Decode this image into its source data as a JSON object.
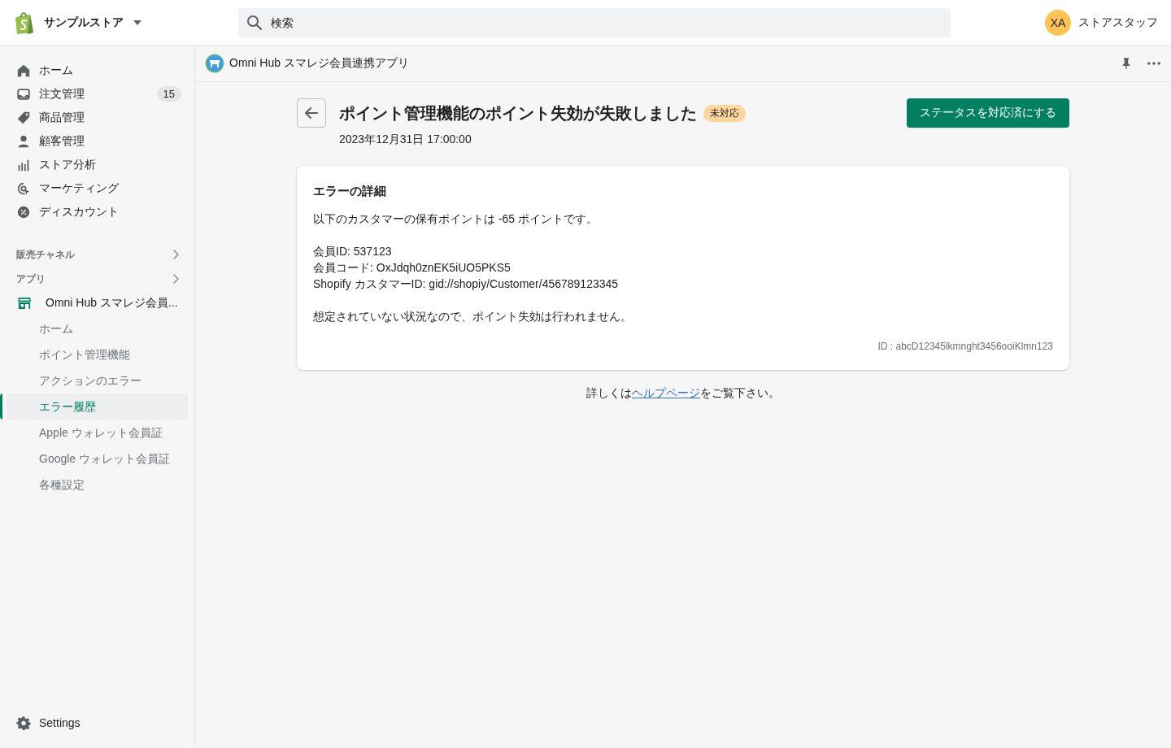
{
  "topbar": {
    "store_name": "サンプルストア",
    "search": {
      "placeholder": "検索"
    },
    "user": {
      "initials": "XA",
      "name": "ストアスタッフ"
    }
  },
  "sidebar": {
    "items": [
      {
        "label": "ホーム"
      },
      {
        "label": "注文管理",
        "badge": "15"
      },
      {
        "label": "商品管理"
      },
      {
        "label": "顧客管理"
      },
      {
        "label": "ストア分析"
      },
      {
        "label": "マーケティング"
      },
      {
        "label": "ディスカウント"
      }
    ],
    "sections": [
      {
        "label": "販売チャネル"
      },
      {
        "label": "アプリ"
      }
    ],
    "app": {
      "label": "Omni Hub スマレジ会員...",
      "children": [
        {
          "label": "ホーム",
          "selected": false
        },
        {
          "label": "ポイント管理機能",
          "selected": false
        },
        {
          "label": "アクションのエラー",
          "selected": false
        },
        {
          "label": "エラー履歴",
          "selected": true
        },
        {
          "label": "Apple ウォレット会員証",
          "selected": false
        },
        {
          "label": "Google ウォレット会員証",
          "selected": false
        },
        {
          "label": "各種設定",
          "selected": false
        }
      ]
    },
    "settings": "Settings"
  },
  "app_header": {
    "title": "Omni Hub スマレジ会員連携アプリ"
  },
  "page": {
    "title": "ポイント管理機能のポイント失効が失敗しました",
    "status": "未対応",
    "date": "2023年12月31日 17:00:00",
    "action": "ステータスを対応済にする",
    "card": {
      "heading": "エラーの詳細",
      "paragraphs": [
        [
          "以下のカスタマーの保有ポイントは -65 ポイントです。"
        ],
        [
          "会員ID: 537123",
          "会員コード: OxJdqh0znEK5iUO5PKS5",
          "Shopify カスタマーID: gid://shopiy/Customer/456789123345"
        ],
        [
          "想定されていない状況なので、ポイント失効は行われません。"
        ]
      ],
      "id": "ID : abcD12345lkmnght3456ooiKlmn123"
    },
    "help": {
      "before": "詳しくは",
      "link": "ヘルプページ",
      "after": "をご覧下さい。"
    }
  }
}
